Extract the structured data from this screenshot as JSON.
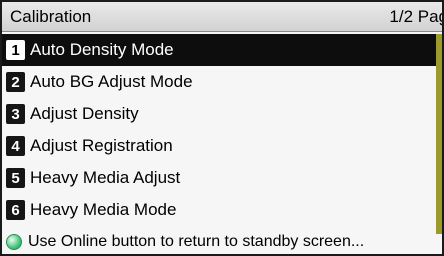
{
  "header": {
    "title": "Calibration",
    "page": "1/2 Pag"
  },
  "menu": {
    "items": [
      {
        "num": "1",
        "label": "Auto Density Mode"
      },
      {
        "num": "2",
        "label": "Auto BG Adjust Mode"
      },
      {
        "num": "3",
        "label": "Adjust Density"
      },
      {
        "num": "4",
        "label": "Adjust Registration"
      },
      {
        "num": "5",
        "label": "Heavy Media Adjust"
      },
      {
        "num": "6",
        "label": "Heavy Media Mode"
      }
    ]
  },
  "footer": {
    "text": "Use Online button to return to standby screen...",
    "icon": "online-button-icon"
  },
  "colors": {
    "selected_bg": "#0d0d0d",
    "accent": "#9c9a2a",
    "online": "#48c47c"
  }
}
